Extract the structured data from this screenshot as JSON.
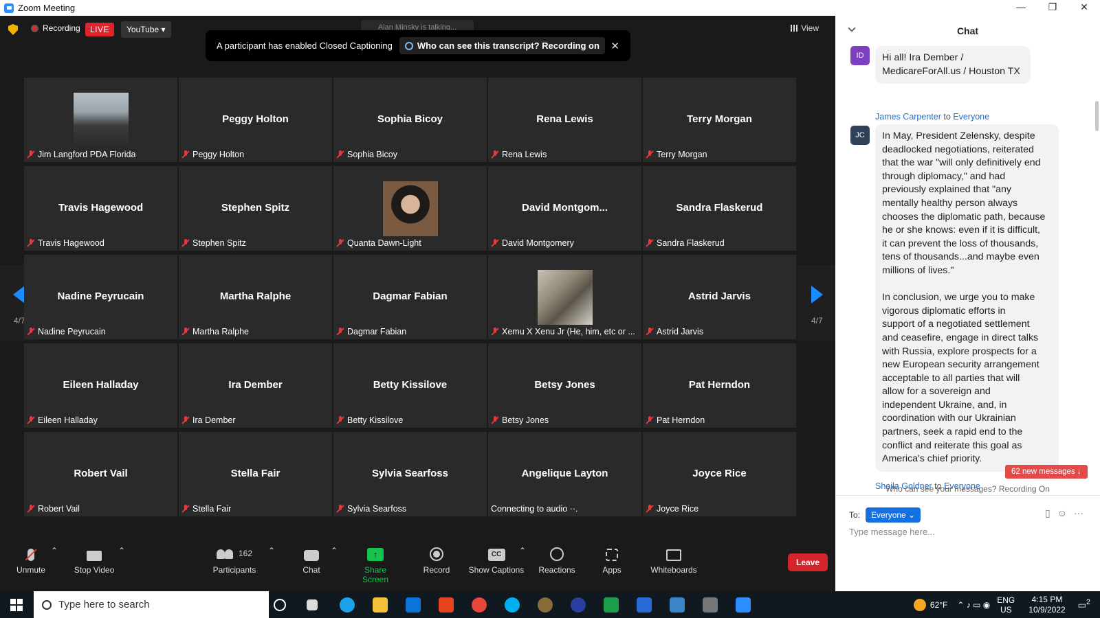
{
  "window": {
    "title": "Zoom Meeting",
    "controls": [
      "—",
      "❐",
      "✕"
    ]
  },
  "topbar": {
    "recording_label": "Recording",
    "live_label": "LIVE",
    "stream_label": "YouTube ▾",
    "talking": "Alan Minsky is talking...",
    "view_label": "View"
  },
  "banner": {
    "text": "A participant has enabled Closed Captioning",
    "who": "Who can see this transcript? Recording on",
    "close": "✕"
  },
  "tiles": [
    {
      "big": "",
      "label": "Jim Langford PDA Florida",
      "photo": "ph1"
    },
    {
      "big": "Peggy Holton",
      "label": "Peggy Holton"
    },
    {
      "big": "Sophia Bicoy",
      "label": "Sophia Bicoy"
    },
    {
      "big": "Rena Lewis",
      "label": "Rena Lewis"
    },
    {
      "big": "Terry Morgan",
      "label": "Terry Morgan"
    },
    {
      "big": "Travis Hagewood",
      "label": "Travis Hagewood"
    },
    {
      "big": "Stephen Spitz",
      "label": "Stephen Spitz"
    },
    {
      "big": "",
      "label": "Quanta Dawn-Light",
      "photo": "ph2"
    },
    {
      "big": "David  Montgom...",
      "label": "David Montgomery"
    },
    {
      "big": "Sandra Flaskerud",
      "label": "Sandra Flaskerud"
    },
    {
      "big": "Nadine Peyrucain",
      "label": "Nadine Peyrucain"
    },
    {
      "big": "Martha Ralphe",
      "label": "Martha Ralphe"
    },
    {
      "big": "Dagmar Fabian",
      "label": "Dagmar Fabian"
    },
    {
      "big": "",
      "label": "Xemu X Xenu Jr (He, him, etc or ...",
      "photo": "ph3"
    },
    {
      "big": "Astrid Jarvis",
      "label": "Astrid Jarvis"
    },
    {
      "big": "Eileen Halladay",
      "label": "Eileen Halladay"
    },
    {
      "big": "Ira Dember",
      "label": "Ira Dember"
    },
    {
      "big": "Betty Kissilove",
      "label": "Betty Kissilove"
    },
    {
      "big": "Betsy Jones",
      "label": "Betsy Jones"
    },
    {
      "big": "Pat Herndon",
      "label": "Pat Herndon"
    },
    {
      "big": "Robert Vail",
      "label": "Robert Vail"
    },
    {
      "big": "Stella Fair",
      "label": "Stella Fair"
    },
    {
      "big": "Sylvia Searfoss",
      "label": "Sylvia Searfoss"
    },
    {
      "big": "Angelique Layton",
      "label": "Connecting to audio ··.",
      "nomic": true
    },
    {
      "big": "Joyce Rice",
      "label": "Joyce Rice"
    }
  ],
  "pager": {
    "left": "4/7",
    "right": "4/7"
  },
  "toolbar": {
    "unmute": "Unmute",
    "stop_video": "Stop Video",
    "participants": "Participants",
    "participants_count": "162",
    "chat": "Chat",
    "share": "Share Screen",
    "record": "Record",
    "captions": "Show Captions",
    "cc": "CC",
    "reactions": "Reactions",
    "apps": "Apps",
    "whiteboards": "Whiteboards",
    "leave": "Leave"
  },
  "chat": {
    "title": "Chat",
    "messages": [
      {
        "initials": "ID",
        "color": "#7b3fbf",
        "text": "Hi all! Ira Dember /\nMedicareForAll.us / Houston TX"
      },
      {
        "sender": "James Carpenter",
        "to_word": " to ",
        "to": "Everyone",
        "initials": "JC",
        "color": "#2f4157",
        "text": "In May, President Zelensky, despite\ndeadlocked negotiations, reiterated\nthat the war \"will only definitively end\nthrough diplomacy,\" and had\npreviously explained that \"any\nmentally healthy person always\nchooses the diplomatic path, because\nhe or she knows: even if it is difficult,\nit can prevent the loss of thousands,\ntens of thousands...and maybe even\nmillions of lives.\"\n\nIn conclusion, we urge you to make\nvigorous diplomatic efforts in\nsupport of a negotiated settlement\nand ceasefire, engage in direct talks\nwith Russia, explore prospects for a\nnew European security arrangement\nacceptable to all parties that will\nallow for a sovereign and\nindependent Ukraine, and, in\ncoordination with our Ukrainian\npartners, seek a rapid end to the\nconflict and reiterate this goal as\nAmerica's chief priority."
      },
      {
        "sender": "Sheila Goldner",
        "to_word": " to ",
        "to": "Everyone"
      }
    ],
    "new_messages": "62 new messages ↓",
    "who_can_see": "Who can see your messages? Recording On",
    "to_label": "To:",
    "recipient": "Everyone ⌄",
    "placeholder": "Type message here..."
  },
  "taskbar": {
    "search_placeholder": "Type here to search",
    "weather": "62°F",
    "lang1": "ENG",
    "lang2": "US",
    "time": "4:15 PM",
    "date": "10/9/2022",
    "notif": "2"
  }
}
